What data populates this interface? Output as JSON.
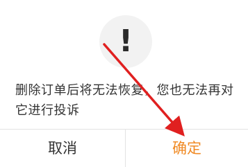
{
  "dialog": {
    "icon": "exclamation-icon",
    "icon_glyph": "!",
    "message": "删除订单后将无法恢复，您也无法再对它进行投诉",
    "cancel_label": "取消",
    "confirm_label": "确定"
  },
  "colors": {
    "confirm": "#f08a24",
    "text": "#333333",
    "annotation_arrow": "#e02020"
  }
}
